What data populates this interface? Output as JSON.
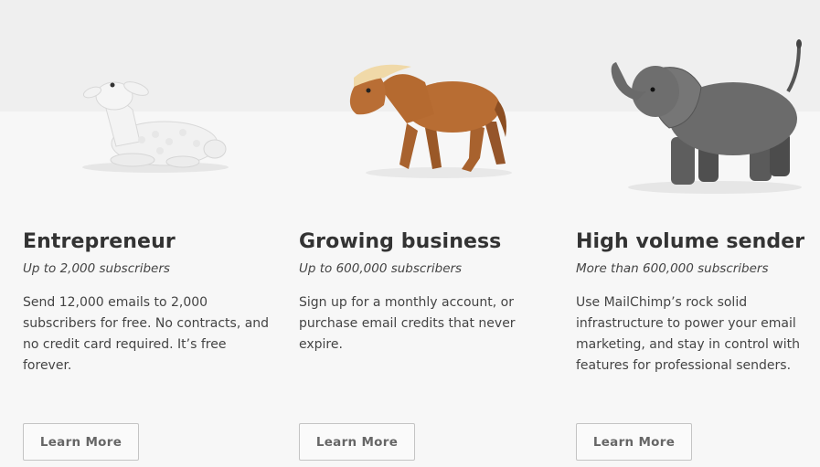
{
  "plans": [
    {
      "title": "Entrepreneur",
      "subtitle": "Up to 2,000 subscribers",
      "description": "Send 12,000 emails to 2,000 subscribers for free. No contracts, and no credit card required. It’s free forever.",
      "button_label": "Learn More",
      "image": "lamb-figurine"
    },
    {
      "title": "Growing business",
      "subtitle": "Up to 600,000 subscribers",
      "description": "Sign up for a monthly account, or purchase email credits that never expire.",
      "button_label": "Learn More",
      "image": "pony-figurine"
    },
    {
      "title": "High volume sender",
      "subtitle": "More than 600,000 subscribers",
      "description": "Use MailChimp’s rock solid infrastructure to power your email marketing, and stay in control with features for professional senders.",
      "button_label": "Learn More",
      "image": "elephant-figurine"
    }
  ],
  "colors": {
    "page_background": "#f7f7f7",
    "top_band": "#efefef",
    "heading": "#333333",
    "body_text": "#444444",
    "button_border": "#c4c4c4",
    "button_text": "#666666"
  }
}
